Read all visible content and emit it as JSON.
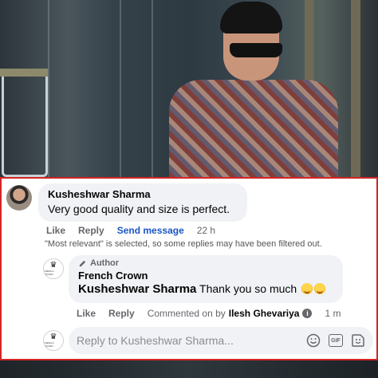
{
  "main_comment": {
    "author": "Kusheshwar Sharma",
    "text": "Very good quality and size is perfect.",
    "actions": {
      "like": "Like",
      "reply": "Reply",
      "send_message": "Send message",
      "time": "22 h"
    }
  },
  "filter_notice": "\"Most relevant\" is selected, so some replies may have been filtered out.",
  "reply": {
    "badge": "Author",
    "author": "French Crown",
    "mention": "Kusheshwar Sharma",
    "text": "Thank you so much",
    "actions": {
      "like": "Like",
      "reply": "Reply",
      "commented_on_by": "Commented on by",
      "commenter": "Ilesh Ghevariya",
      "time": "1 m"
    }
  },
  "brand_avatar": {
    "mark": "♛",
    "caption": "FRENCH CROWN"
  },
  "input": {
    "placeholder": "Reply to Kusheshwar Sharma..."
  },
  "icons": [
    "edit-icon",
    "emoji-icon",
    "gif-icon",
    "sticker-icon",
    "info-icon",
    "crown-icon"
  ],
  "colors": {
    "accent": "#1a55c4",
    "border": "#d32525",
    "bubble": "#f0f2f5",
    "muted": "#65676b"
  }
}
